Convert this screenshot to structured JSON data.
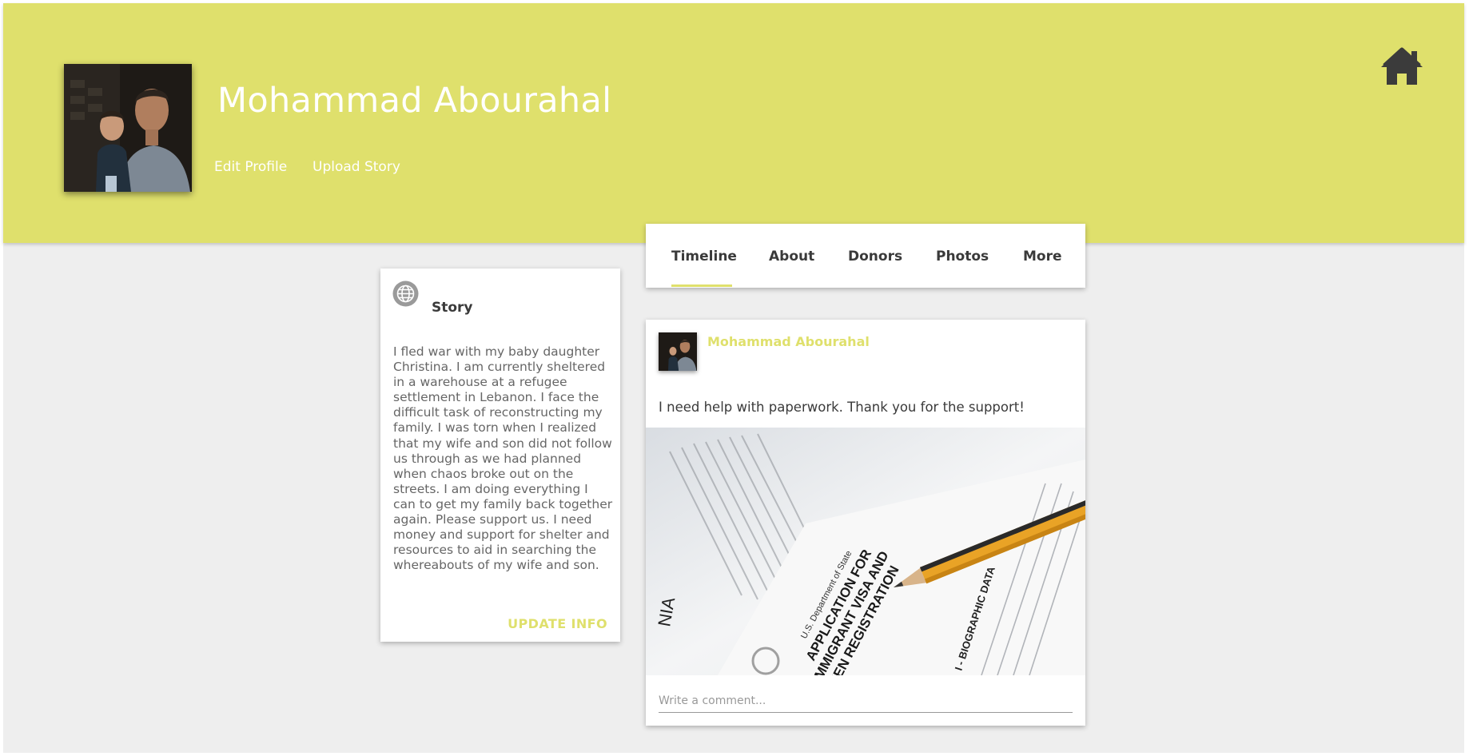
{
  "profile": {
    "name": "Mohammad Abourahal",
    "actions": {
      "edit_profile": "Edit Profile",
      "upload_story": "Upload Story"
    }
  },
  "nav": {
    "home_icon": "home-icon",
    "tabs": [
      {
        "label": "Timeline",
        "active": true
      },
      {
        "label": "About"
      },
      {
        "label": "Donors"
      },
      {
        "label": "Photos"
      },
      {
        "label": "More"
      }
    ]
  },
  "story": {
    "icon": "globe-icon",
    "title": "Story",
    "text": "I fled war with my baby daughter Christina. I am currently sheltered in a warehouse at a refugee settlement in Lebanon. I face the difficult task of reconstructing my family. I was torn when I realized that my wife and son did not follow us through as we had planned when chaos broke out on the streets. I am doing everything I can to get my family back together again. Please support us. I need money and support for shelter and resources to aid in searching the whereabouts of my wife and son.",
    "update_button": "UPDATE INFO"
  },
  "post": {
    "author": "Mohammad Abourahal",
    "text": "I need help with paperwork. Thank you for the support!",
    "image": {
      "line1": "U.S. Department of State",
      "line2": "APPLICATION FOR",
      "line3": "IMMIGRANT VISA AND",
      "line4": "ALIEN REGISTRATION",
      "side1": "NIA",
      "side2": "I - BIOGRAPHIC DATA"
    },
    "comment_placeholder": "Write a comment..."
  },
  "colors": {
    "accent": "#dfe06c",
    "background": "#eeeeee",
    "card": "#ffffff",
    "text_dark": "#3a3a3a",
    "text_muted": "#666666"
  }
}
